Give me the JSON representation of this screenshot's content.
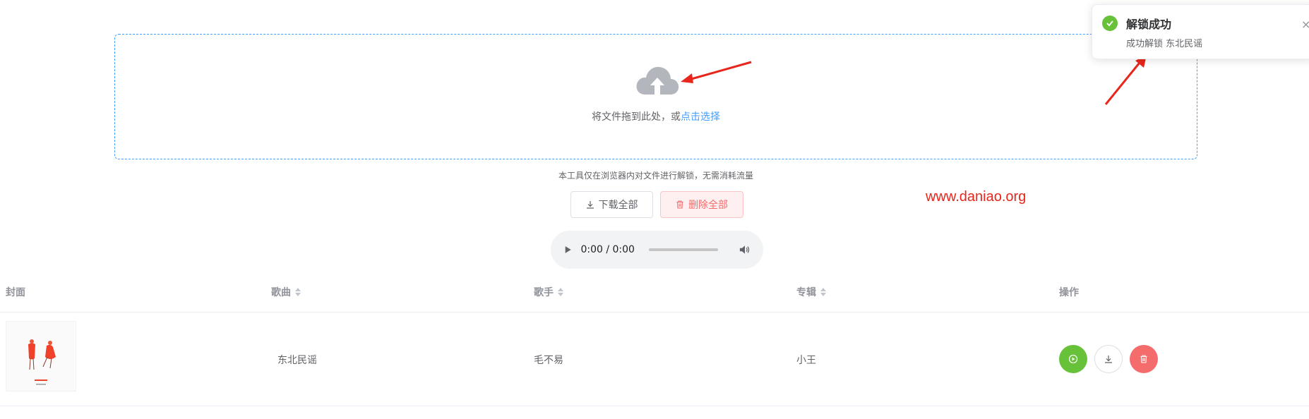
{
  "upload": {
    "hint_prefix": "将文件拖到此处，或",
    "hint_link": "点击选择",
    "note": "本工具仅在浏览器内对文件进行解锁，无需消耗流量"
  },
  "actions": {
    "download_all": "下载全部",
    "delete_all": "删除全部"
  },
  "player": {
    "time": "0:00 / 0:00"
  },
  "watermark": "www.daniao.org",
  "table": {
    "columns": [
      "封面",
      "歌曲",
      "歌手",
      "专辑",
      "操作"
    ],
    "rows": [
      {
        "title": "东北民谣",
        "artist": "毛不易",
        "album": "小王"
      }
    ]
  },
  "toast": {
    "title": "解锁成功",
    "message": "成功解锁 东北民谣",
    "close": "×"
  },
  "colors": {
    "primary": "#409eff",
    "success": "#67c23a",
    "danger": "#f56c6c",
    "annotation_arrow": "#e8261b"
  },
  "icons": [
    "cloud-upload-icon",
    "download-icon",
    "trash-icon",
    "play-icon",
    "volume-icon",
    "sort-icon",
    "check-circle-icon",
    "close-icon",
    "arrow-annotation-icon"
  ]
}
